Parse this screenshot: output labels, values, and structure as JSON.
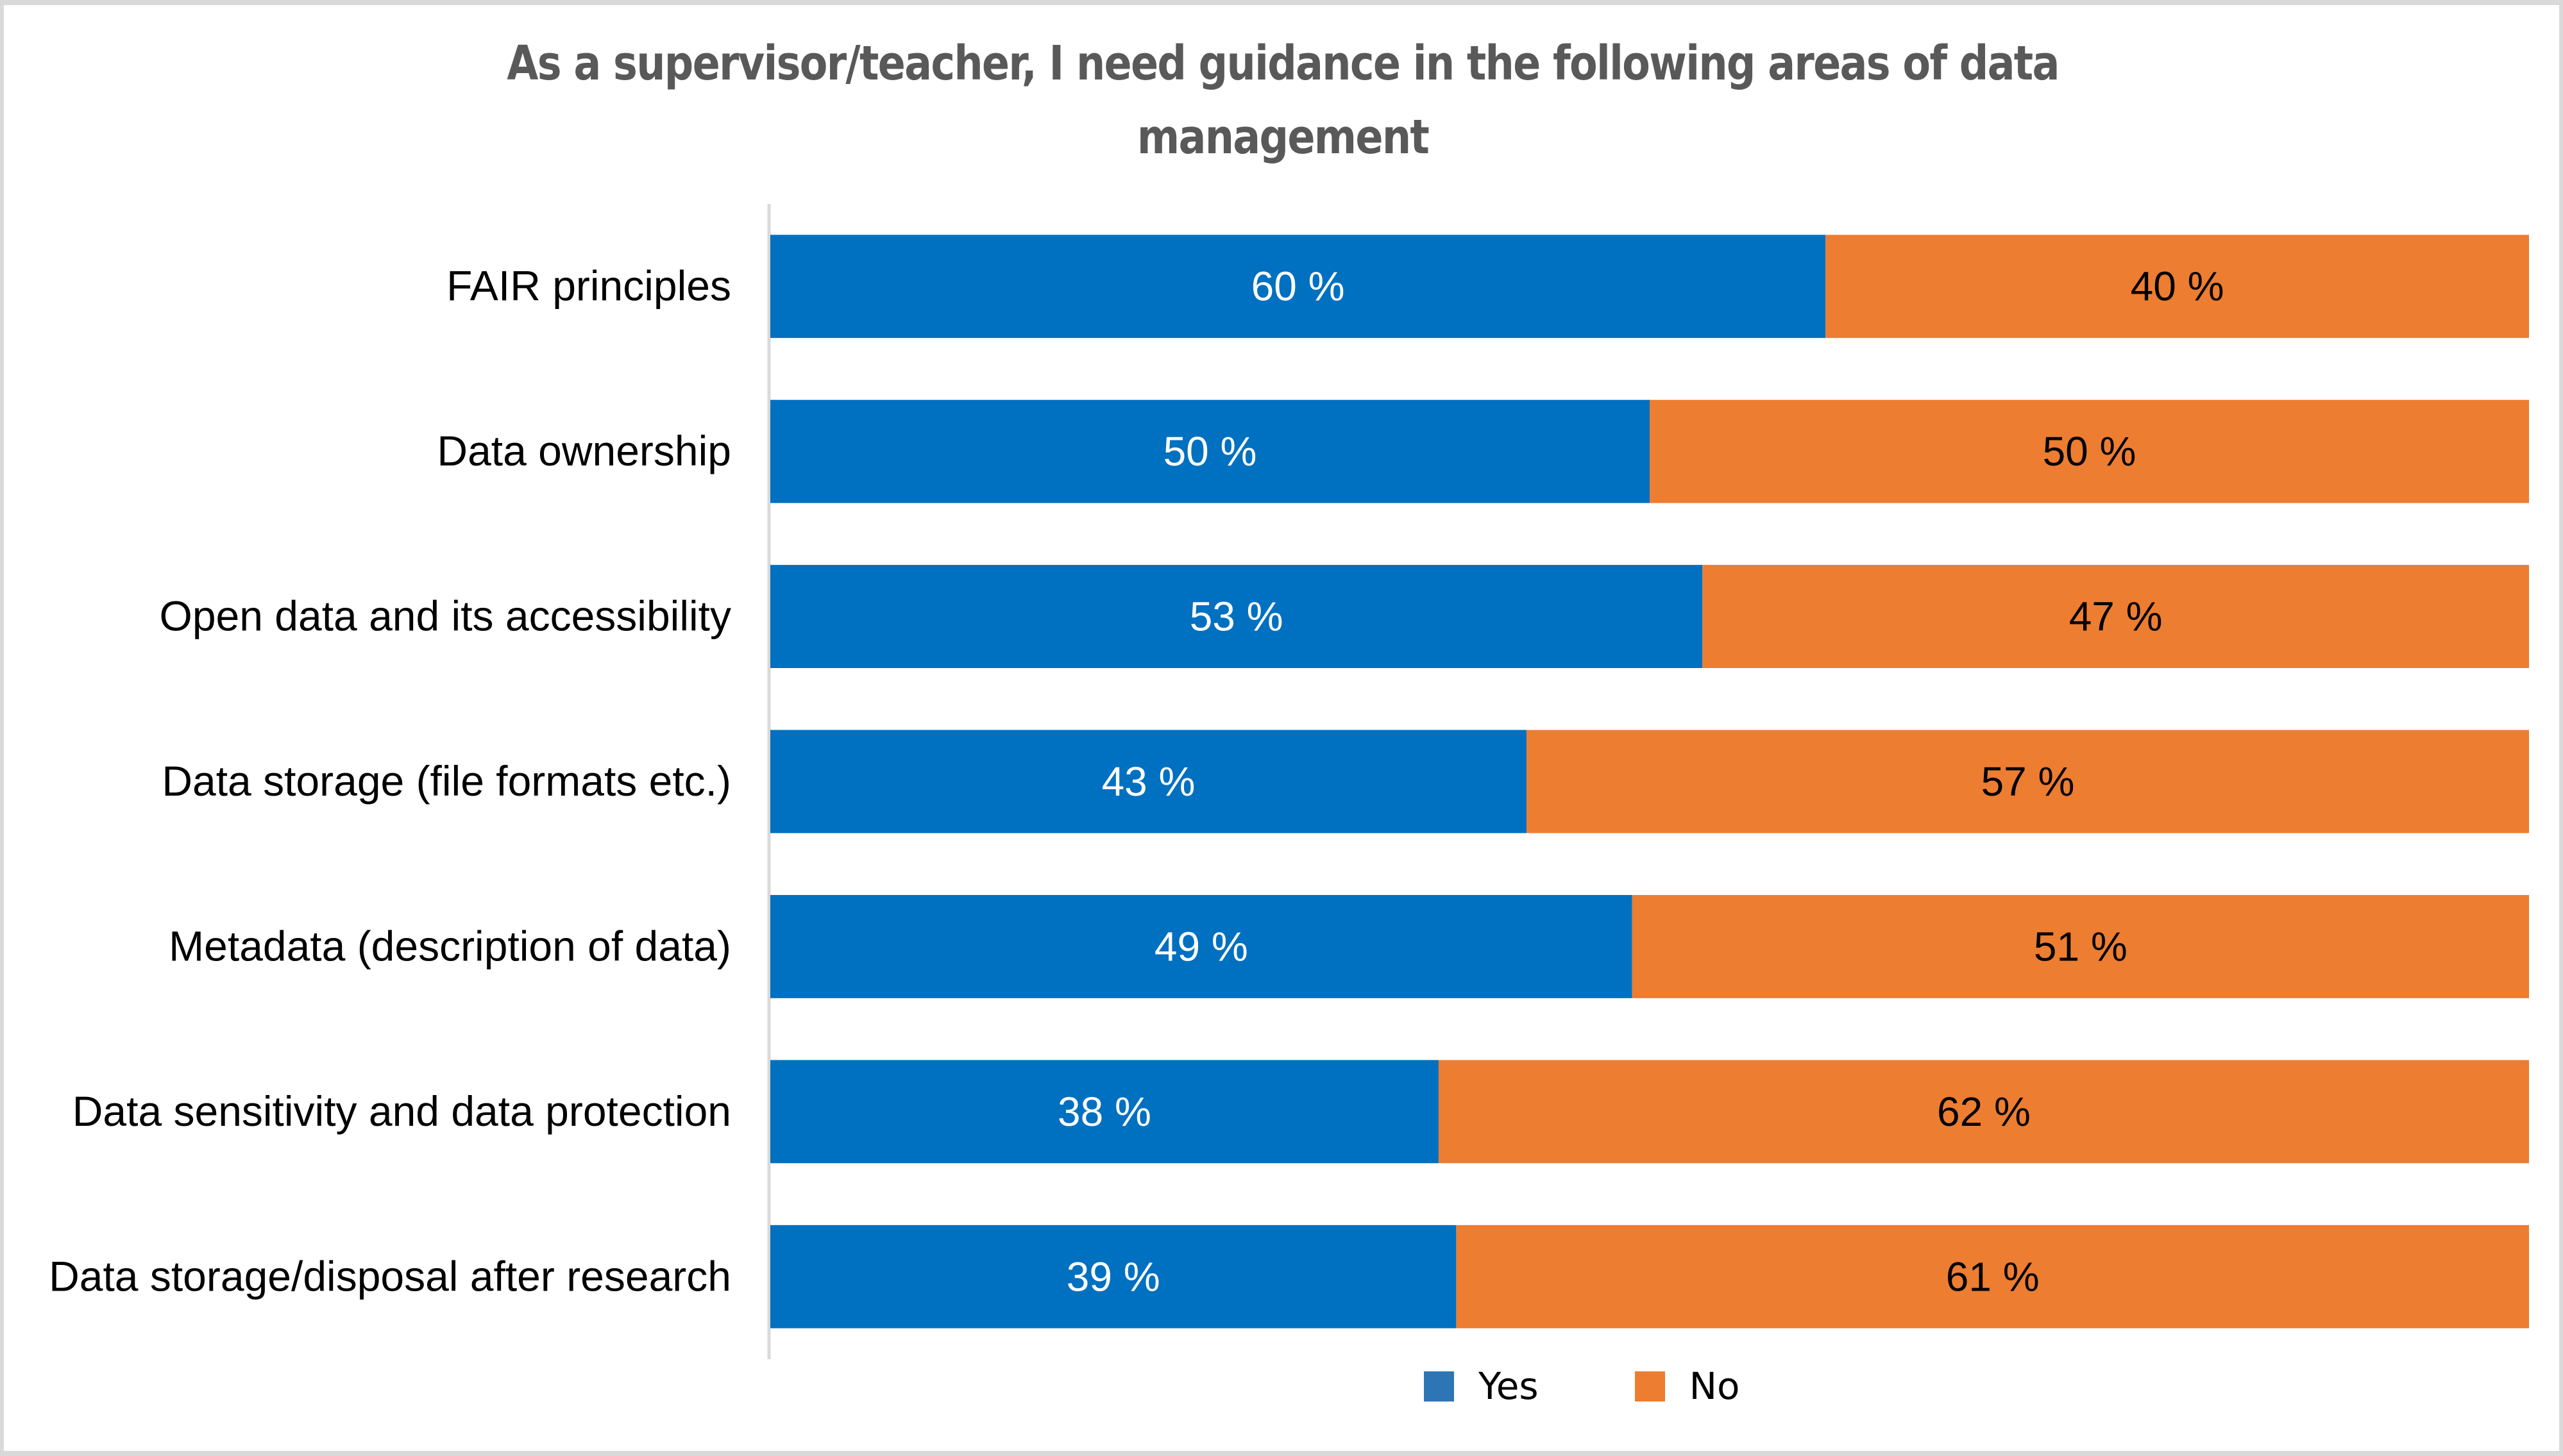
{
  "chart_data": {
    "type": "bar",
    "orientation": "horizontal",
    "stacked": true,
    "percent_stacked": true,
    "title": "As a supervisor/teacher, I need guidance in the following areas of data management",
    "title_lines": [
      "As a supervisor/teacher, I need guidance in the following areas of data",
      "management"
    ],
    "xlabel": "",
    "ylabel": "",
    "xlim": [
      0,
      100
    ],
    "grid": false,
    "legend_position": "bottom",
    "categories": [
      "FAIR principles",
      "Data ownership",
      "Open data and its accessibility",
      "Data storage (file formats etc.)",
      "Metadata (description of data)",
      "Data sensitivity and data protection",
      "Data storage/disposal after research"
    ],
    "series": [
      {
        "name": "Yes",
        "color": "#0070C0",
        "legend_color": "#2E75B6",
        "label_color": "#FFFFFF",
        "values": [
          60,
          50,
          53,
          43,
          49,
          38,
          39
        ],
        "labels": [
          "60 %",
          "50 %",
          "53 %",
          "43 %",
          "49 %",
          "38 %",
          "39 %"
        ]
      },
      {
        "name": "No",
        "color": "#ED7D31",
        "legend_color": "#ED7D31",
        "label_color": "#000000",
        "values": [
          40,
          50,
          47,
          57,
          51,
          62,
          61
        ],
        "labels": [
          "40 %",
          "50 %",
          "47 %",
          "57 %",
          "51 %",
          "62 %",
          "61 %"
        ]
      }
    ]
  },
  "colors": {
    "title": "#595959",
    "axis": "#D9D9D9",
    "frame": "#D9D9D9"
  }
}
